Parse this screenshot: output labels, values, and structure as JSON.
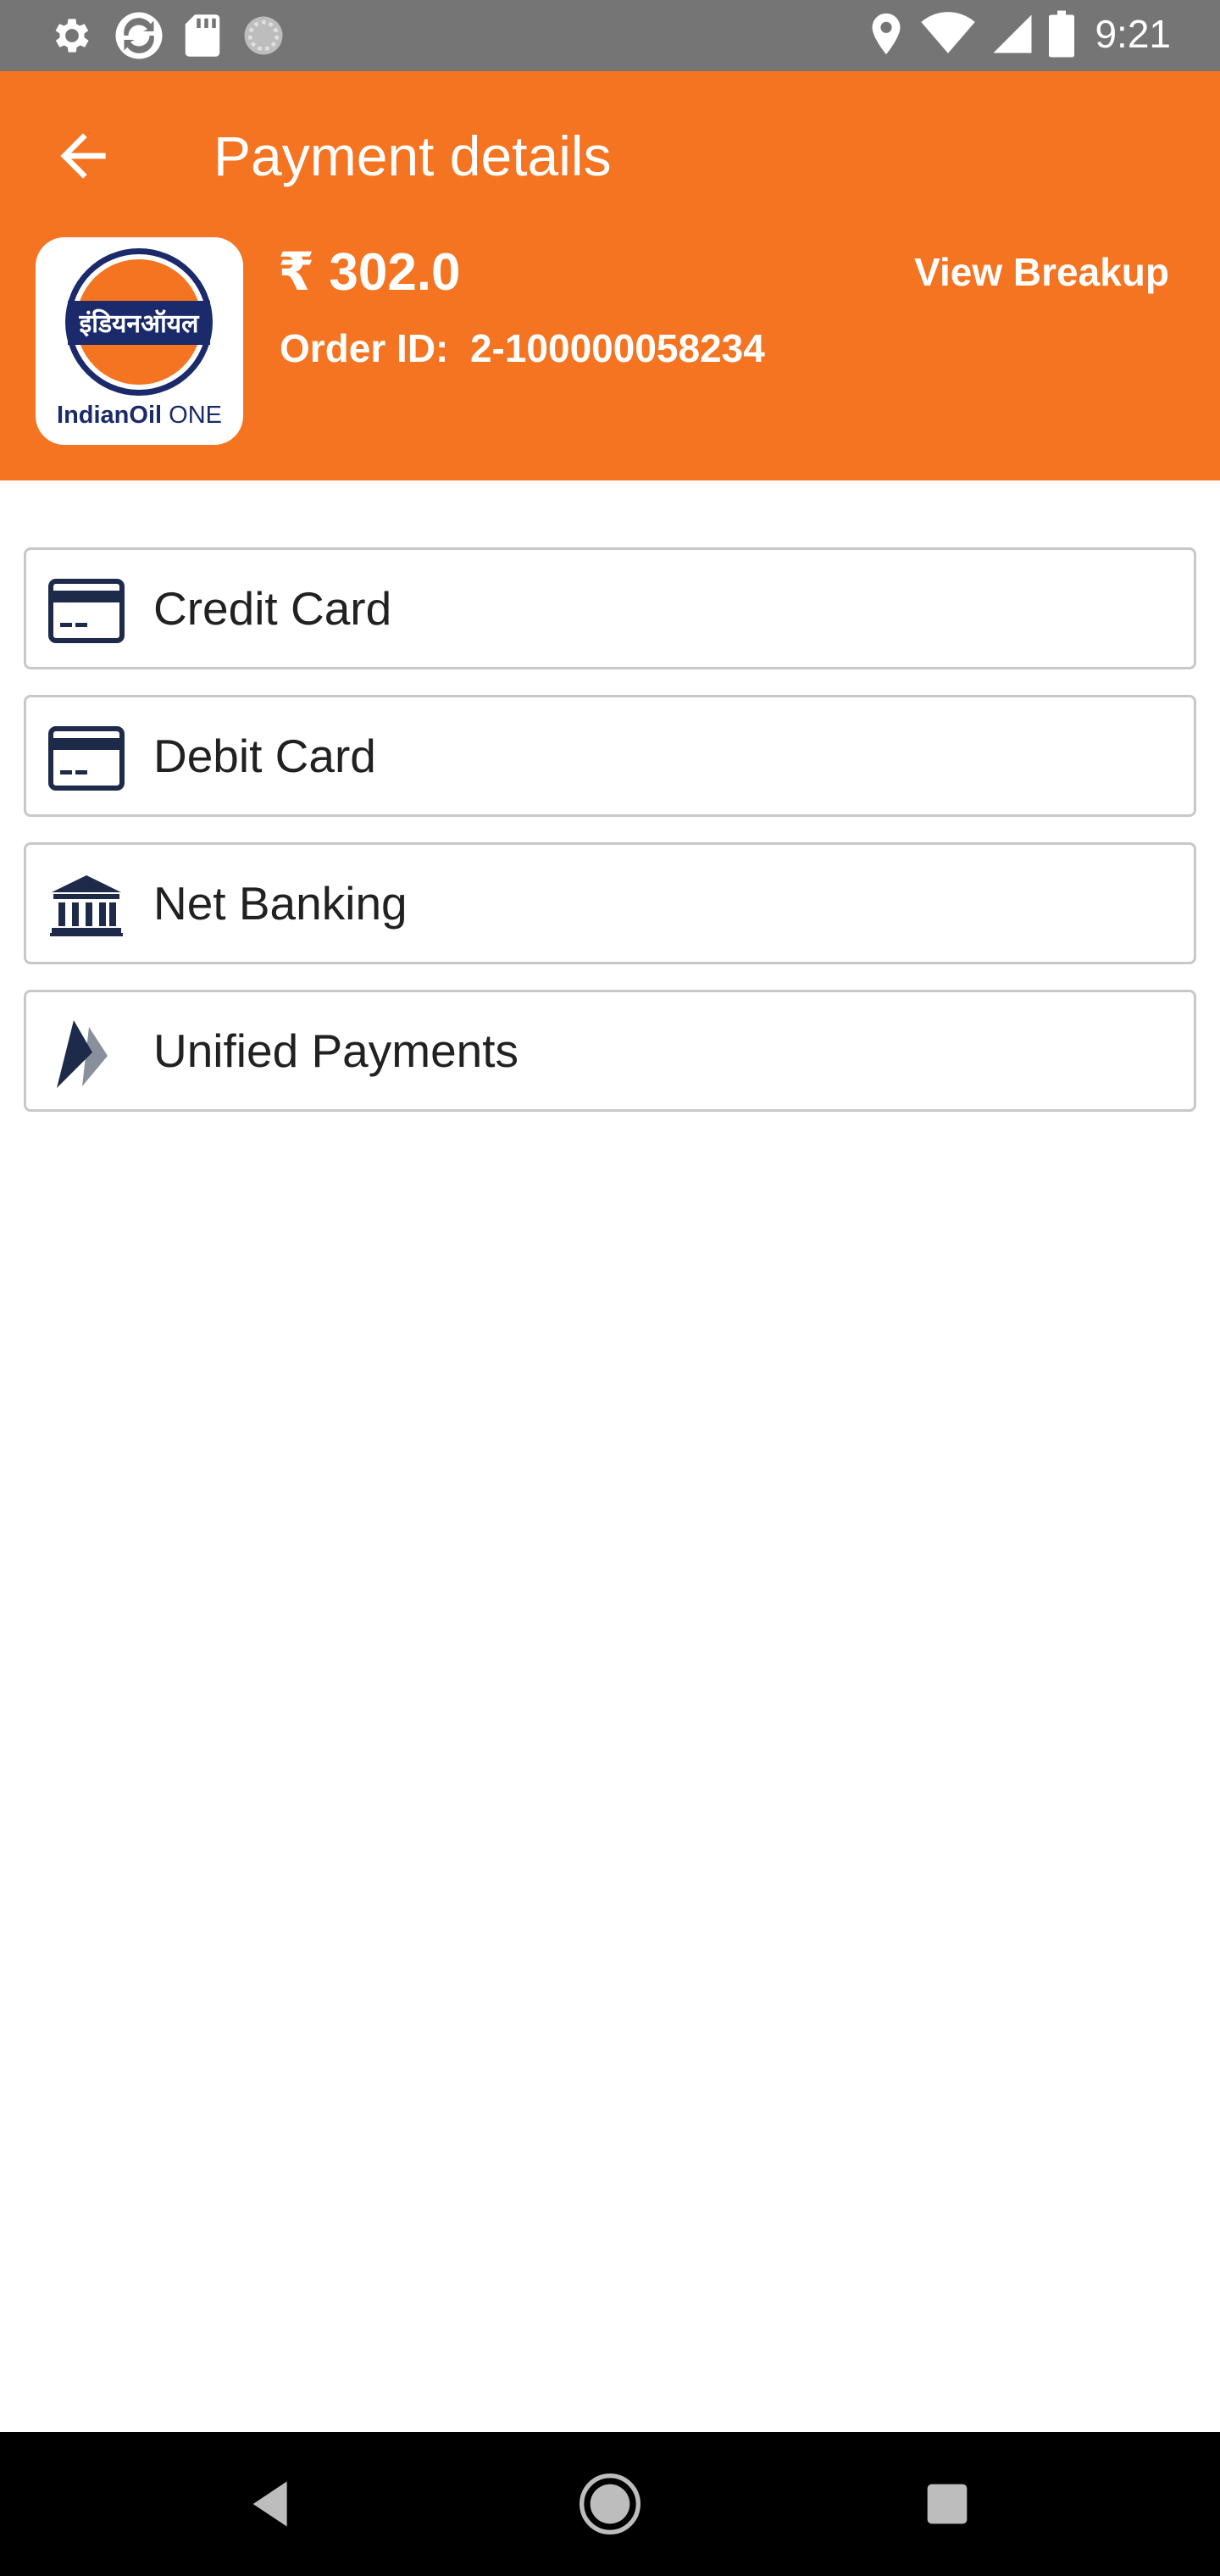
{
  "status_bar": {
    "time": "9:21",
    "left_icons": [
      "gear-icon",
      "sync-icon",
      "sd-card-icon",
      "circle-loader-icon"
    ],
    "right_icons": [
      "location-icon",
      "wifi-icon",
      "signal-icon",
      "battery-icon"
    ]
  },
  "header": {
    "title": "Payment details",
    "amount": "₹ 302.0",
    "order_label": "Order ID:",
    "order_id": "2-100000058234",
    "view_breakup": "View Breakup",
    "brand_color": "#F47421"
  },
  "logo": {
    "devanagari": "इंडियनऑयल",
    "brand_bold": "IndianOil",
    "brand_light": "ONE"
  },
  "payment_methods": [
    {
      "label": "Credit Card",
      "icon": "credit-card-icon"
    },
    {
      "label": "Debit Card",
      "icon": "debit-card-icon"
    },
    {
      "label": "Net Banking",
      "icon": "bank-icon"
    },
    {
      "label": "Unified Payments",
      "icon": "upi-icon"
    }
  ],
  "nav_bar": {
    "buttons": [
      "back-triangle-icon",
      "home-circle-icon",
      "recents-square-icon"
    ]
  }
}
